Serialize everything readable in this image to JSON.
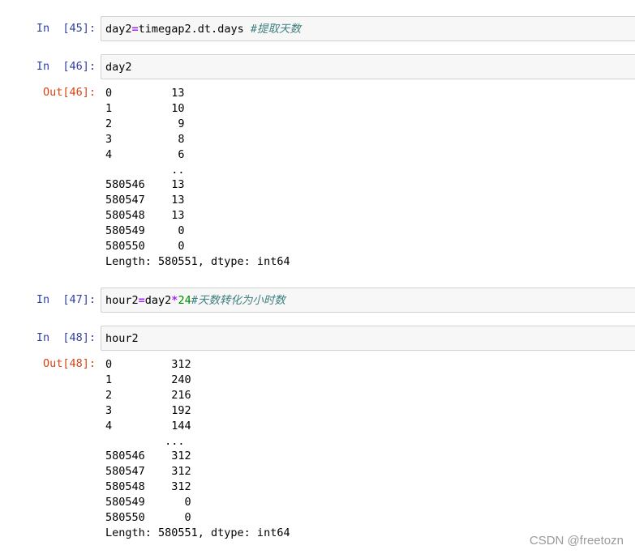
{
  "cells": [
    {
      "in_prompt": "In  [45]:",
      "code": {
        "var": "day2",
        "op": "=",
        "rest": "timegap2.dt.days ",
        "comment": "#提取天数"
      }
    },
    {
      "in_prompt": "In  [46]:",
      "code_text": "day2",
      "out_prompt": "Out[46]:",
      "output": "0         13\n1         10\n2          9\n3          8\n4          6\n          ..\n580546    13\n580547    13\n580548    13\n580549     0\n580550     0\nLength: 580551, dtype: int64"
    },
    {
      "in_prompt": "In  [47]:",
      "code": {
        "var": "hour2",
        "op": "=",
        "mid": "day2",
        "op2": "*",
        "num": "24",
        "comment": "#天数转化为小时数"
      }
    },
    {
      "in_prompt": "In  [48]:",
      "code_text": "hour2",
      "out_prompt": "Out[48]:",
      "output": "0         312\n1         240\n2         216\n3         192\n4         144\n         ...\n580546    312\n580547    312\n580548    312\n580549      0\n580550      0\nLength: 580551, dtype: int64"
    }
  ],
  "watermark": "CSDN @freetozn"
}
